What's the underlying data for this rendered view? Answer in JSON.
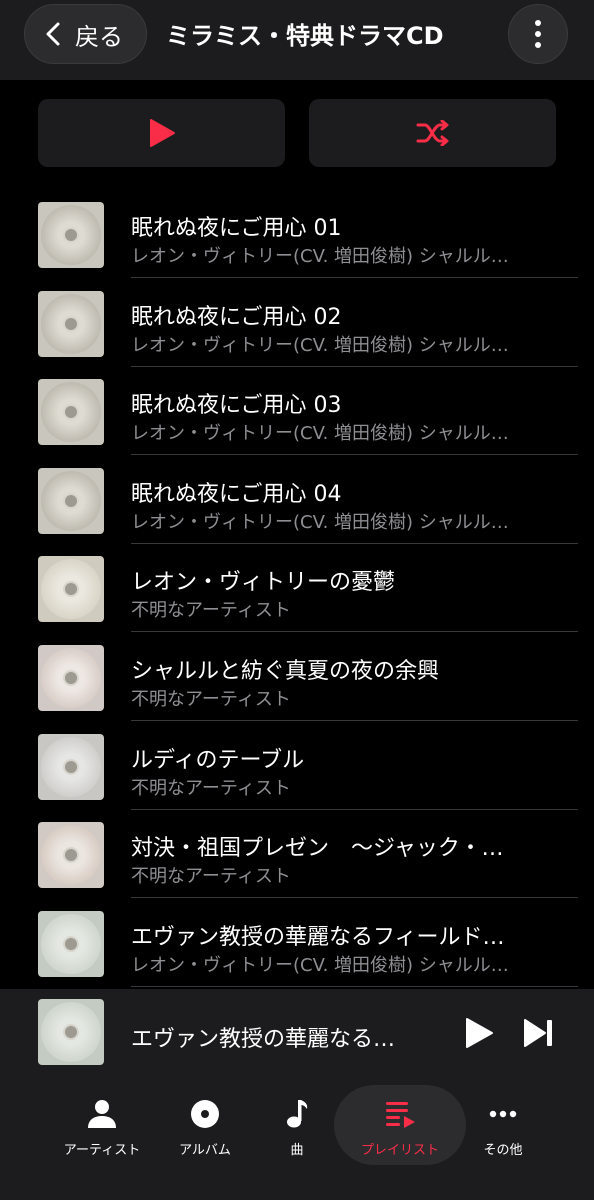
{
  "header": {
    "back_label": "戻る",
    "title": "ミラミス・特典ドラマCD"
  },
  "accent_color": "#fa2d48",
  "tracks": [
    {
      "title": "眠れぬ夜にご用心 01",
      "artist": "レオン・ヴィトリー(CV. 増田俊樹) シャルル…"
    },
    {
      "title": "眠れぬ夜にご用心 02",
      "artist": "レオン・ヴィトリー(CV. 増田俊樹) シャルル…"
    },
    {
      "title": "眠れぬ夜にご用心 03",
      "artist": "レオン・ヴィトリー(CV. 増田俊樹) シャルル…"
    },
    {
      "title": "眠れぬ夜にご用心 04",
      "artist": "レオン・ヴィトリー(CV. 増田俊樹) シャルル…"
    },
    {
      "title": "レオン・ヴィトリーの憂鬱",
      "artist": "不明なアーティスト"
    },
    {
      "title": "シャルルと紡ぐ真夏の夜の余興",
      "artist": "不明なアーティスト"
    },
    {
      "title": "ルディのテーブル",
      "artist": "不明なアーティスト"
    },
    {
      "title": "対決・祖国プレゼン　～ジャック・…",
      "artist": "不明なアーティスト"
    },
    {
      "title": "エヴァン教授の華麗なるフィールド…",
      "artist": "レオン・ヴィトリー(CV. 増田俊樹) シャルル…"
    }
  ],
  "mini_player": {
    "title": "エヴァン教授の華麗なる…"
  },
  "tabs": [
    {
      "label": "アーティスト",
      "icon": "person-icon"
    },
    {
      "label": "アルバム",
      "icon": "album-icon"
    },
    {
      "label": "曲",
      "icon": "music-note-icon"
    },
    {
      "label": "プレイリスト",
      "icon": "playlist-icon",
      "active": true
    },
    {
      "label": "その他",
      "icon": "more-icon"
    }
  ]
}
